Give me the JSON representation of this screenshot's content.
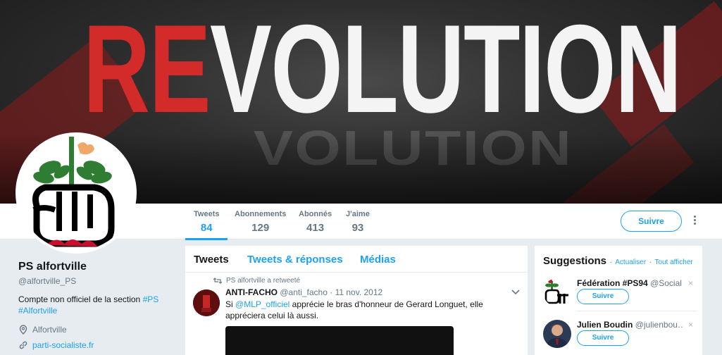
{
  "banner": {
    "title_red": "RE",
    "title_white": "VOLUTION",
    "shadow_text": "VOLUTION"
  },
  "profile": {
    "name": "PS alfortville",
    "handle": "@alfortville_PS",
    "bio_prefix": "Compte non officiel de la section ",
    "bio_hashtag1": "#PS",
    "bio_hashtag2": "#Alfortville",
    "location": "Alfortville",
    "website": "parti-socialiste.fr",
    "location_icon": "location-pin-icon",
    "link_icon": "link-icon"
  },
  "nav": {
    "stats": [
      {
        "label": "Tweets",
        "value": "84"
      },
      {
        "label": "Abonnements",
        "value": "129"
      },
      {
        "label": "Abonnés",
        "value": "413"
      },
      {
        "label": "J'aime",
        "value": "93"
      }
    ],
    "follow_label": "Suivre"
  },
  "timeline": {
    "tabs": [
      "Tweets",
      "Tweets & réponses",
      "Médias"
    ],
    "retweet_notice": "PS alfortville a retweeté",
    "tweet": {
      "author_name": "ANTI-FACHO",
      "author_handle": "@anti_facho",
      "date": "11 nov. 2012",
      "separator": "·",
      "text_prefix": "Si ",
      "mention": "@MLP_officiel",
      "text_suffix": " apprécie le bras d'honneur de Gerard Longuet, elle appréciera celui là aussi."
    }
  },
  "suggestions": {
    "title": "Suggestions",
    "sep": "·",
    "refresh": "Actualiser",
    "view_all": "Tout afficher",
    "items": [
      {
        "name": "Fédération #PS94",
        "handle": "@Social…",
        "button": "Suivre",
        "close": "×"
      },
      {
        "name": "Julien Boudin",
        "handle": "@julienbou…",
        "button": "Suivre",
        "close": "×"
      }
    ]
  },
  "colors": {
    "accent": "#1da1f2",
    "banner_red": "#d32a2a",
    "ps_red": "#c8102e",
    "ps_green": "#2e7d32"
  }
}
